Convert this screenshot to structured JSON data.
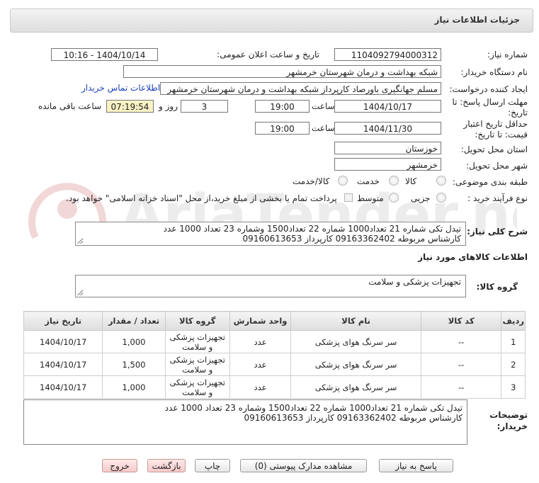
{
  "header": {
    "title": "جزئیات اطلاعات نیاز"
  },
  "watermark": {
    "text": "AriaTender.net"
  },
  "fields": {
    "need_number_label": "شماره نیاز:",
    "need_number": "1104092794000312",
    "announce_label": "تاریخ و ساعت اعلان عمومی:",
    "announce_value": "1404/10/14 - 10:16",
    "buyer_org_label": "نام دستگاه خریدار:",
    "buyer_org": "شبکه بهداشت و درمان شهرستان خرمشهر",
    "creator_label": "ایجاد کننده درخواست:",
    "creator": "مسلم جهانگیری باورصاد کارپرداز شبکه بهداشت و درمان شهرستان خرمشهر",
    "contact_link": "اطلاعات تماس خریدار",
    "reply_deadline_label": "مهلت ارسال پاسخ: تا تاریخ:",
    "reply_date": "1404/10/17",
    "time_label": "ساعت",
    "reply_time": "19:00",
    "days_value": "3",
    "days_label": "روز و",
    "remaining_time": "07:19:54",
    "remaining_label": "ساعت باقی مانده",
    "price_validity_label": "حداقل تاریخ اعتبار قیمت: تا تاریخ:",
    "validity_date": "1404/11/30",
    "validity_time": "19:00",
    "province_label": "استان محل تحویل:",
    "province": "خوزستان",
    "city_label": "شهر محل تحویل:",
    "city": "خرمشهر",
    "category_label": "طبقه بندی موضوعی:",
    "category_options": [
      "کالا",
      "خدمت",
      "کالا/خدمت"
    ],
    "process_label": "نوع فرآیند خرید :",
    "process_options": [
      "جزیی",
      "متوسط"
    ],
    "payment_note": "پرداخت تمام یا بخشی از مبلغ خرید،از محل \"اسناد خزانه اسلامی\" خواهد بود.",
    "summary_label": "شرح کلی نیاز:",
    "summary_line1": "تیدل تکی شماره 21 تعداد1000 شماره 22 تعداد1500 وشماره 23 تعداد 1000 عدد",
    "summary_line2": "کارشناس مربوطه 09163362402 کارپرداز 09160613653",
    "goods_info_title": "اطلاعات کالاهای مورد نیاز",
    "goods_group_label": "گروه کالا:",
    "goods_group": "تجهیزات پزشکی و سلامت"
  },
  "table": {
    "headers": [
      "ردیف",
      "کد کالا",
      "نام کالا",
      "واحد شمارش",
      "گروه کالا",
      "تعداد / مقدار",
      "تاریخ نیاز"
    ],
    "rows": [
      [
        "1",
        "--",
        "سر سرنگ هوای پزشکی",
        "عدد",
        "تجهیزات پزشکی و سلامت",
        "1,000",
        "1404/10/17"
      ],
      [
        "2",
        "--",
        "سر سرنگ هوای پزشکی",
        "عدد",
        "تجهیزات پزشکی و سلامت",
        "1,500",
        "1404/10/17"
      ],
      [
        "3",
        "--",
        "سر سرنگ هوای پزشکی",
        "عدد",
        "تجهیزات پزشکی و سلامت",
        "1,000",
        "1404/10/17"
      ]
    ]
  },
  "buyer_notes": {
    "label_line1": "توضیحات",
    "label_line2": "خریدار:",
    "line1": "تیدل تکی شماره 21 تعداد1000 شماره 22 تعداد1500 وشماره 23 تعداد 1000 عدد",
    "line2": "کارشناس مربوطه 09163362402 کارپرداز 09160613653"
  },
  "buttons": {
    "reply": "پاسخ به نیاز",
    "attachments": "مشاهده مدارک پیوستی (0)",
    "print": "چاپ",
    "back": "بازگشت",
    "exit": "خروج"
  }
}
